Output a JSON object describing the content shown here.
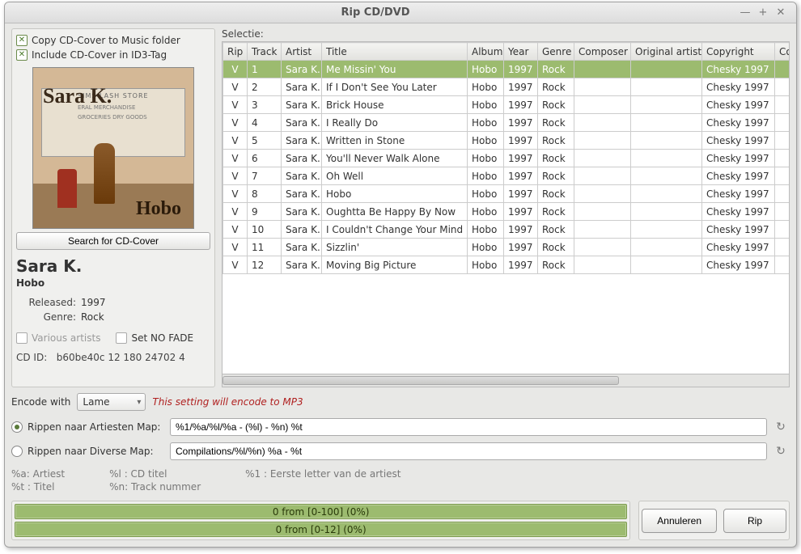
{
  "window": {
    "title": "Rip CD/DVD"
  },
  "left": {
    "copy_cover": "Copy CD-Cover to Music folder",
    "include_cover": "Include CD-Cover in ID3-Tag",
    "cover_artist": "Sara K.",
    "cover_title": "Hobo",
    "cover_sign1": "SIMS LASH STORE",
    "cover_sign2": "ERAL MERCHANDISE",
    "cover_sign3": "GROCERIES   DRY GOODS",
    "search_btn": "Search for CD-Cover",
    "artist": "Sara K.",
    "album": "Hobo",
    "released_lbl": "Released:",
    "released_val": "1997",
    "genre_lbl": "Genre:",
    "genre_val": "Rock",
    "various": "Various artists",
    "nofade": "Set NO FADE",
    "cdid_lbl": "CD ID:",
    "cdid_val": "b60be40c 12 180 24702 4"
  },
  "table": {
    "selectie": "Selectie:",
    "headers": [
      "Rip",
      "Track",
      "Artist",
      "Title",
      "Album",
      "Year",
      "Genre",
      "Composer",
      "Original artist",
      "Copyright",
      "Comm"
    ],
    "rows": [
      {
        "rip": "V",
        "track": "1",
        "artist": "Sara K.",
        "title": "Me Missin' You",
        "album": "Hobo",
        "year": "1997",
        "genre": "Rock",
        "composer": "",
        "orig": "",
        "copy": "Chesky 1997"
      },
      {
        "rip": "V",
        "track": "2",
        "artist": "Sara K.",
        "title": "If I Don't See You Later",
        "album": "Hobo",
        "year": "1997",
        "genre": "Rock",
        "composer": "",
        "orig": "",
        "copy": "Chesky 1997"
      },
      {
        "rip": "V",
        "track": "3",
        "artist": "Sara K.",
        "title": "Brick House",
        "album": "Hobo",
        "year": "1997",
        "genre": "Rock",
        "composer": "",
        "orig": "",
        "copy": "Chesky 1997"
      },
      {
        "rip": "V",
        "track": "4",
        "artist": "Sara K.",
        "title": "I Really Do",
        "album": "Hobo",
        "year": "1997",
        "genre": "Rock",
        "composer": "",
        "orig": "",
        "copy": "Chesky 1997"
      },
      {
        "rip": "V",
        "track": "5",
        "artist": "Sara K.",
        "title": "Written in Stone",
        "album": "Hobo",
        "year": "1997",
        "genre": "Rock",
        "composer": "",
        "orig": "",
        "copy": "Chesky 1997"
      },
      {
        "rip": "V",
        "track": "6",
        "artist": "Sara K.",
        "title": "You'll Never Walk Alone",
        "album": "Hobo",
        "year": "1997",
        "genre": "Rock",
        "composer": "",
        "orig": "",
        "copy": "Chesky 1997"
      },
      {
        "rip": "V",
        "track": "7",
        "artist": "Sara K.",
        "title": "Oh Well",
        "album": "Hobo",
        "year": "1997",
        "genre": "Rock",
        "composer": "",
        "orig": "",
        "copy": "Chesky 1997"
      },
      {
        "rip": "V",
        "track": "8",
        "artist": "Sara K.",
        "title": "Hobo",
        "album": "Hobo",
        "year": "1997",
        "genre": "Rock",
        "composer": "",
        "orig": "",
        "copy": "Chesky 1997"
      },
      {
        "rip": "V",
        "track": "9",
        "artist": "Sara K.",
        "title": "Oughtta Be Happy By Now",
        "album": "Hobo",
        "year": "1997",
        "genre": "Rock",
        "composer": "",
        "orig": "",
        "copy": "Chesky 1997"
      },
      {
        "rip": "V",
        "track": "10",
        "artist": "Sara K.",
        "title": "I Couldn't Change Your Mind",
        "album": "Hobo",
        "year": "1997",
        "genre": "Rock",
        "composer": "",
        "orig": "",
        "copy": "Chesky 1997"
      },
      {
        "rip": "V",
        "track": "11",
        "artist": "Sara K.",
        "title": "Sizzlin'",
        "album": "Hobo",
        "year": "1997",
        "genre": "Rock",
        "composer": "",
        "orig": "",
        "copy": "Chesky 1997"
      },
      {
        "rip": "V",
        "track": "12",
        "artist": "Sara K.",
        "title": "Moving Big Picture",
        "album": "Hobo",
        "year": "1997",
        "genre": "Rock",
        "composer": "",
        "orig": "",
        "copy": "Chesky 1997"
      }
    ]
  },
  "encode": {
    "label": "Encode with",
    "value": "Lame",
    "note": "This setting will encode to MP3"
  },
  "paths": {
    "artist_lbl": "Rippen naar Artiesten Map:",
    "artist_val": "%1/%a/%l/%a - (%l) - %n) %t",
    "diverse_lbl": "Rippen naar Diverse Map:",
    "diverse_val": "Compilations/%l/%n) %a - %t"
  },
  "legend": {
    "a": "%a: Artiest",
    "t": "%t : Titel",
    "l": "%l : CD titel",
    "n": "%n: Track nummer",
    "one": "%1 : Eerste letter van de artiest"
  },
  "progress": {
    "p1": "0 from [0-100] (0%)",
    "p2": "0 from [0-12] (0%)"
  },
  "buttons": {
    "cancel": "Annuleren",
    "rip": "Rip"
  }
}
